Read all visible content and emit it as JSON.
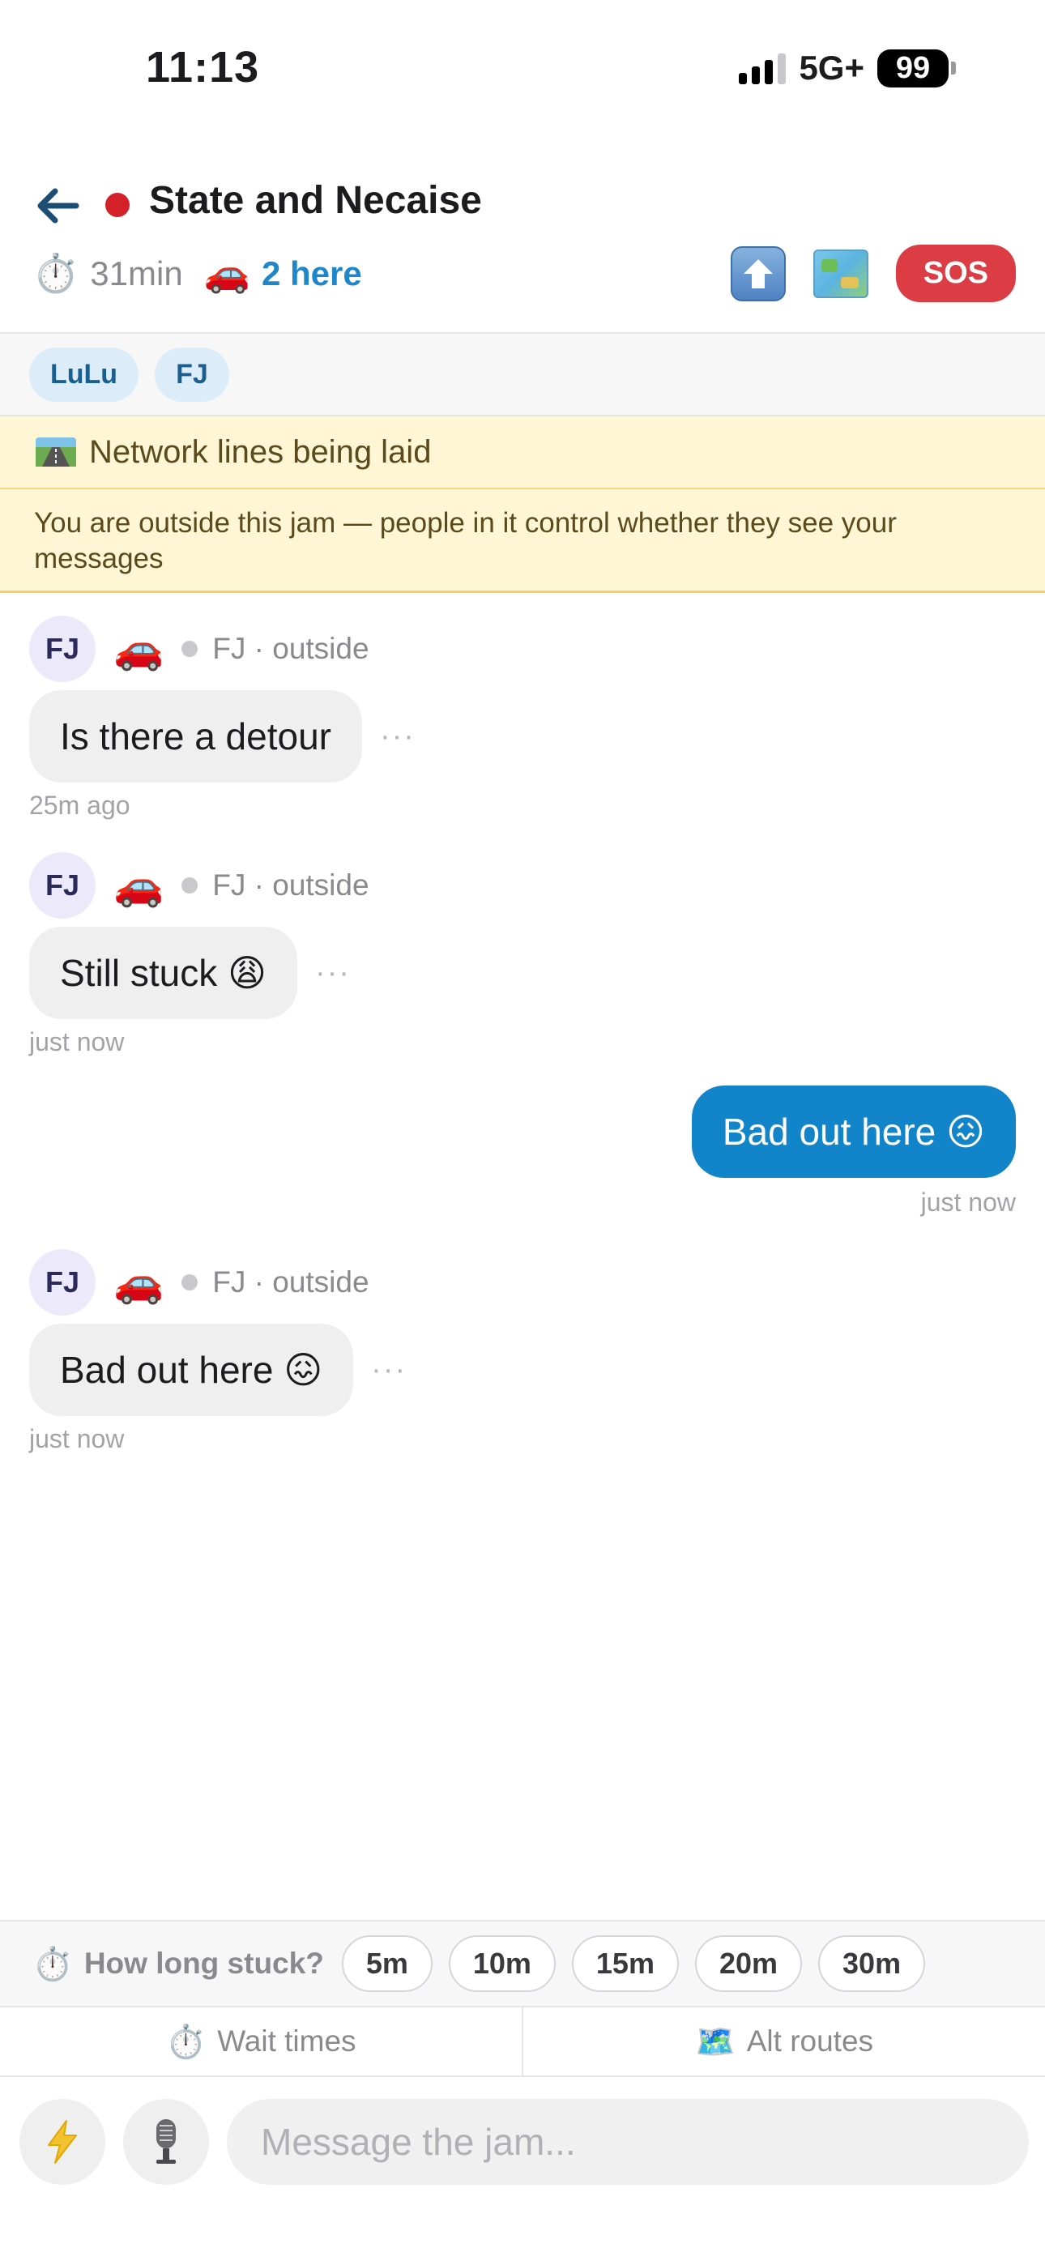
{
  "status_bar": {
    "time": "11:13",
    "network": "5G+",
    "battery": "99"
  },
  "header": {
    "title": "State and Necaise",
    "duration": "31min",
    "here_count": "2 here",
    "sos_label": "SOS"
  },
  "participants": [
    "LuLu",
    "FJ"
  ],
  "banners": {
    "network": "Network lines being laid",
    "outside_notice": "You are outside this jam — people in it control whether they see your messages"
  },
  "messages": [
    {
      "avatar": "FJ",
      "sender": "FJ · outside",
      "text": "Is there a detour",
      "time": "25m ago"
    },
    {
      "avatar": "FJ",
      "sender": "FJ · outside",
      "text": "Still stuck 😩",
      "time": "just now"
    },
    {
      "mine": true,
      "text": "Bad out here 😖",
      "time": "just now"
    },
    {
      "avatar": "FJ",
      "sender": "FJ · outside",
      "text": "Bad out here 😖",
      "time": "just now"
    }
  ],
  "more_glyph": "···",
  "quick_bar": {
    "label": "How long stuck?",
    "options": [
      "5m",
      "10m",
      "15m",
      "20m",
      "30m"
    ]
  },
  "tabs": {
    "wait_times": "Wait times",
    "alt_routes": "Alt routes"
  },
  "composer": {
    "placeholder": "Message the jam..."
  },
  "colors": {
    "accent": "#1284c9",
    "sos": "#dc3d45",
    "banner": "#fff6d6"
  }
}
